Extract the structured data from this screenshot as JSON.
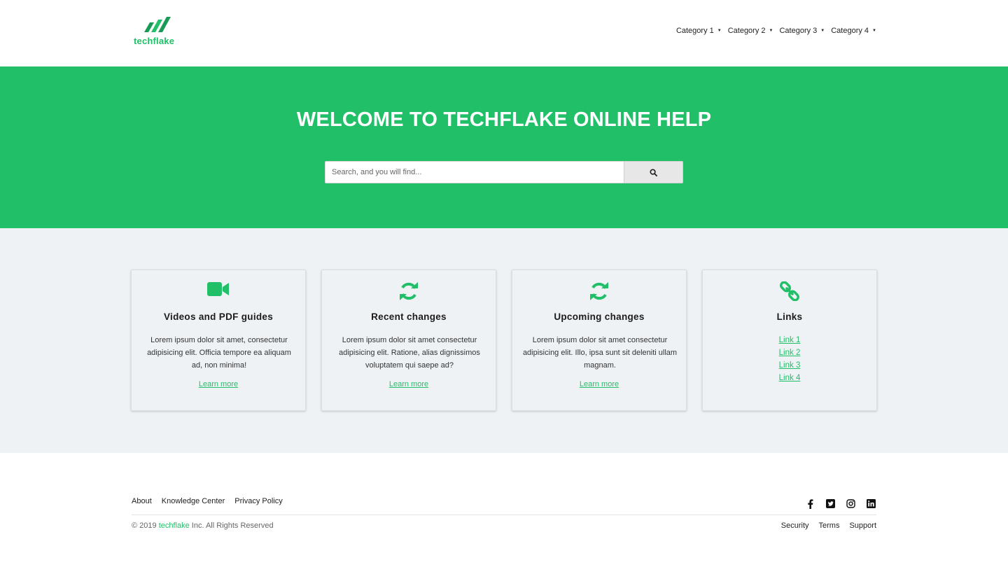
{
  "header": {
    "brand": "techflake",
    "nav": [
      {
        "label": "Category 1"
      },
      {
        "label": "Category 2"
      },
      {
        "label": "Category 3"
      },
      {
        "label": "Category 4"
      }
    ]
  },
  "hero": {
    "title": "WELCOME TO TECHFLAKE ONLINE HELP",
    "search_placeholder": "Search, and you will find..."
  },
  "cards": [
    {
      "icon": "video-camera-icon",
      "title": "Videos and PDF guides",
      "text": "Lorem ipsum dolor sit amet, consectetur adipisicing elit. Officia tempore ea aliquam ad, non minima!",
      "link": "Learn more"
    },
    {
      "icon": "refresh-icon",
      "title": "Recent changes",
      "text": "Lorem ipsum dolor sit amet consectetur adipisicing elit. Ratione, alias dignissimos voluptatem qui saepe ad?",
      "link": "Learn more"
    },
    {
      "icon": "refresh-icon",
      "title": "Upcoming changes",
      "text": "Lorem ipsum dolor sit amet consectetur adipisicing elit. Illo, ipsa sunt sit deleniti ullam magnam.",
      "link": "Learn more"
    },
    {
      "icon": "chain-link-icon",
      "title": "Links",
      "links": [
        "Link 1",
        "Link 2",
        "Link 3",
        "Link 4"
      ]
    }
  ],
  "footer": {
    "links": [
      "About",
      "Knowledge Center",
      "Privacy Policy"
    ],
    "social": [
      "facebook-icon",
      "twitter-icon",
      "instagram-icon",
      "linkedin-icon"
    ],
    "copyright_prefix": "© 2019 ",
    "copyright_brand": "techflake",
    "copyright_suffix": " Inc. All Rights Reserved",
    "bottom_links": [
      "Security",
      "Terms",
      "Support"
    ]
  },
  "colors": {
    "accent": "#21bf68",
    "section_bg": "#eff2f5"
  }
}
